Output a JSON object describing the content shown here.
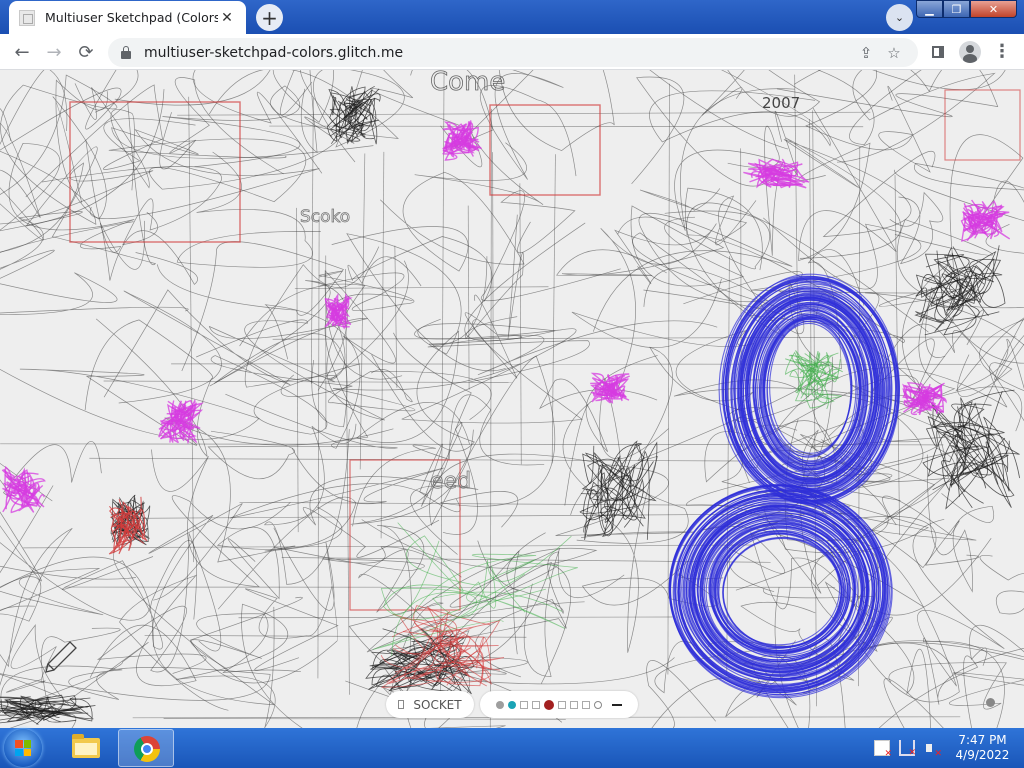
{
  "browser": {
    "tab": {
      "title": "Multiuser Sketchpad (Colors)",
      "close": "✕"
    },
    "new_tab": "+",
    "tab_search": "⌄",
    "window": {
      "minimize": "▁",
      "maximize": "❐",
      "close": "✕"
    },
    "nav": {
      "back": "←",
      "forward": "→",
      "reload": "⟳"
    },
    "url": "multiuser-sketchpad-colors.glitch.me",
    "icons": [
      "lock-icon",
      "share-icon",
      "bookmark-star-icon",
      "side-panel-icon",
      "profile-icon",
      "menu-icon"
    ],
    "share_glyph": "⇪",
    "star_glyph": "☆",
    "menu_glyph": "⋮"
  },
  "sketchpad": {
    "drawn_text": [
      "2007",
      "Come",
      "eed",
      "Scoko"
    ],
    "socket_label": "SOCKET",
    "palette": [
      {
        "kind": "dot",
        "color": "#9e9e9e"
      },
      {
        "kind": "dot",
        "color": "#1aa3b5"
      },
      {
        "kind": "box",
        "color": "#ffffff"
      },
      {
        "kind": "box",
        "color": "#ffffff"
      },
      {
        "kind": "dot",
        "color": "#a32020",
        "selected": true
      },
      {
        "kind": "box",
        "color": "#ffffff"
      },
      {
        "kind": "box",
        "color": "#ffffff"
      },
      {
        "kind": "box",
        "color": "#ffffff"
      },
      {
        "kind": "ring",
        "color": "#ffffff"
      }
    ],
    "stroke_colors": {
      "pencil": "#3a3a3a",
      "red": "#d23b3b",
      "magenta": "#d63be0",
      "blue": "#2f2fd8",
      "green": "#3fae49"
    }
  },
  "taskbar": {
    "clock_time": "7:47 PM",
    "clock_date": "4/9/2022",
    "apps": [
      "windows-explorer",
      "google-chrome"
    ]
  }
}
